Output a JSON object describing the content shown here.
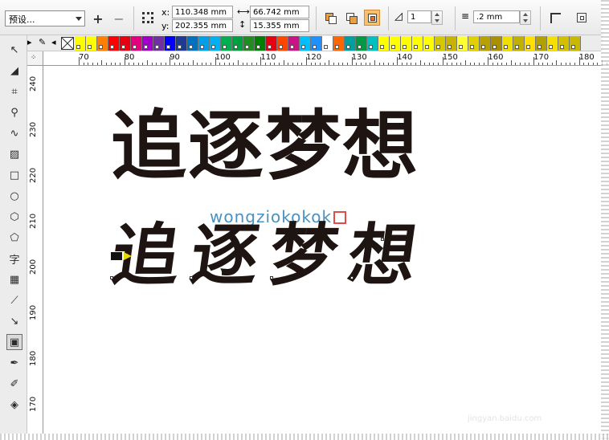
{
  "property_bar": {
    "preset": "预设...",
    "add_preset": "+",
    "remove_preset": "−",
    "x_label": "x:",
    "x_value": "110.348 mm",
    "y_label": "y:",
    "y_value": "202.355 mm",
    "width_value": "66.742 mm",
    "height_value": "15.355 mm",
    "count_value": "1",
    "outline_value": ".2 mm"
  },
  "palette": {
    "colors": [
      "#ffff00",
      "#ffff00",
      "#ff8000",
      "#ff0000",
      "#e60012",
      "#e4007f",
      "#a000c8",
      "#7030a0",
      "#0000ff",
      "#1f3a93",
      "#0070c0",
      "#00a0e9",
      "#00b0f0",
      "#00b050",
      "#00a040",
      "#228b22",
      "#008000",
      "#e60012",
      "#ff4500",
      "#c71585",
      "#00bfff",
      "#1e90ff",
      "#ffffff",
      "#ff6600",
      "#00a0a0",
      "#009944",
      "#00c0c0",
      "#ffff00",
      "#ffff00",
      "#ffff00",
      "#ffff00",
      "#ffff00",
      "#d4c800",
      "#c8b400",
      "#ffff33",
      "#e0d000",
      "#b8a000",
      "#a89000",
      "#f0e000",
      "#c0b000",
      "#ffe000",
      "#b0a000",
      "#f5e000",
      "#d0c000",
      "#c8b800"
    ]
  },
  "ruler_top": [
    "70",
    "80",
    "90",
    "100",
    "110",
    "120",
    "130",
    "140",
    "150",
    "160",
    "170",
    "180"
  ],
  "ruler_left": [
    "240",
    "230",
    "220",
    "210",
    "200",
    "190",
    "180",
    "170"
  ],
  "canvas": {
    "title_bold": "追逐梦想",
    "watermark": "wongziokokok",
    "title_brush": "追逐梦想",
    "footer_watermark": "jingyan.baidu.com"
  },
  "tools": [
    "pick-tool",
    "shape-tool",
    "crop-tool",
    "zoom-tool",
    "freehand-tool",
    "smart-fill-tool",
    "rectangle-tool",
    "ellipse-tool",
    "polygon-tool",
    "basic-shapes-tool",
    "text-tool",
    "table-tool",
    "dimension-tool",
    "connector-tool",
    "interactive-tool",
    "eyedropper-tool",
    "outline-tool",
    "fill-tool"
  ],
  "text_tool_glyph": "字"
}
